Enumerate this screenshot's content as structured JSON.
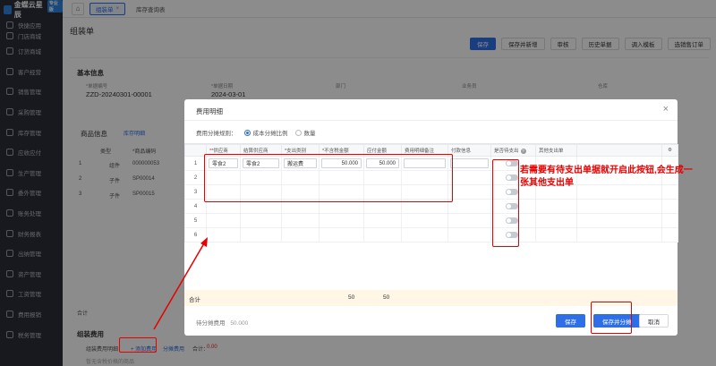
{
  "app": {
    "logo_text": "金蝶云星辰",
    "logo_badge": "专业版"
  },
  "sidebar": {
    "items": [
      {
        "label": "快捷应用"
      },
      {
        "label": "订货商城"
      },
      {
        "label": "客户经营"
      },
      {
        "label": "销售管理"
      },
      {
        "label": "采购管理"
      },
      {
        "label": "库存管理"
      },
      {
        "label": "应收应付"
      },
      {
        "label": "生产管理"
      },
      {
        "label": "委外管理"
      },
      {
        "label": "账务处理"
      },
      {
        "label": "财务报表"
      },
      {
        "label": "出纳管理"
      },
      {
        "label": "资产管理"
      },
      {
        "label": "工资管理"
      },
      {
        "label": "费用报销"
      },
      {
        "label": "税务管理"
      }
    ],
    "sub_label": "门店商城"
  },
  "tabs": [
    {
      "label": "组装单"
    },
    {
      "label": "库存查询表"
    }
  ],
  "page": {
    "title": "组装单",
    "toolbar": [
      "保存",
      "保存并新增",
      "审核",
      "历史单据",
      "调入模板",
      "选销售订单"
    ],
    "basic_section": "基本信息",
    "fields": [
      {
        "label": "*单据编号",
        "value": "ZZD-20240301-00001"
      },
      {
        "label": "*单据日期",
        "value": "2024-03-01"
      },
      {
        "label": "部门",
        "value": ""
      },
      {
        "label": "业务员",
        "value": ""
      },
      {
        "label": "仓库",
        "value": ""
      }
    ],
    "product_section": "商品信息",
    "stock_detail": "库存明细",
    "product_rows": [
      {
        "no": "1",
        "type": "组件",
        "code": "000000053"
      },
      {
        "no": "2",
        "type": "子件",
        "code": "SP00014"
      },
      {
        "no": "3",
        "type": "子件",
        "code": "SP00015"
      }
    ],
    "product_headers": {
      "type": "类型",
      "code": "*商品编码"
    },
    "subtotal": "合计",
    "cost_section": "组装费用",
    "cost_detail_label": "组装费用明细",
    "add_cost": "添加费用",
    "alloc_cost": "分摊费用",
    "alloc_amount_label": "合计：",
    "alloc_amount": "0.00",
    "bottom_hint": "暂无含税价格的商品"
  },
  "modal": {
    "title": "费用明细",
    "rule_label": "费用分摊规则：",
    "rule_options": [
      {
        "label": "成本分摊比例",
        "checked": true
      },
      {
        "label": "数量",
        "checked": false
      }
    ],
    "columns": [
      "*供应商",
      "结算供应商",
      "*支出类别",
      "*不含税金额",
      "应付金额",
      "费用明细备注",
      "付款信息",
      "是否待支出",
      "其他支出单"
    ],
    "rows": [
      {
        "no": "1",
        "supplier": "零食2",
        "settle": "零食2",
        "category": "搬运费",
        "amount": "50.000",
        "payable": "50.000"
      },
      {
        "no": "2"
      },
      {
        "no": "3"
      },
      {
        "no": "4"
      },
      {
        "no": "5"
      },
      {
        "no": "6"
      }
    ],
    "total_label": "合计",
    "total_amount": "50",
    "total_payable": "50",
    "pending_label": "待分摊费用",
    "pending_value": "50.000",
    "save": "保存",
    "save_alloc": "保存并分摊",
    "cancel": "取消"
  },
  "annotation": {
    "text": "若需要有待支出单据就开启此按钮,会生成一张其他支出单"
  },
  "colors": {
    "primary": "#2e6fe8",
    "annotation_red": "#e60000",
    "sidebar_bg": "#2b2f3a"
  }
}
